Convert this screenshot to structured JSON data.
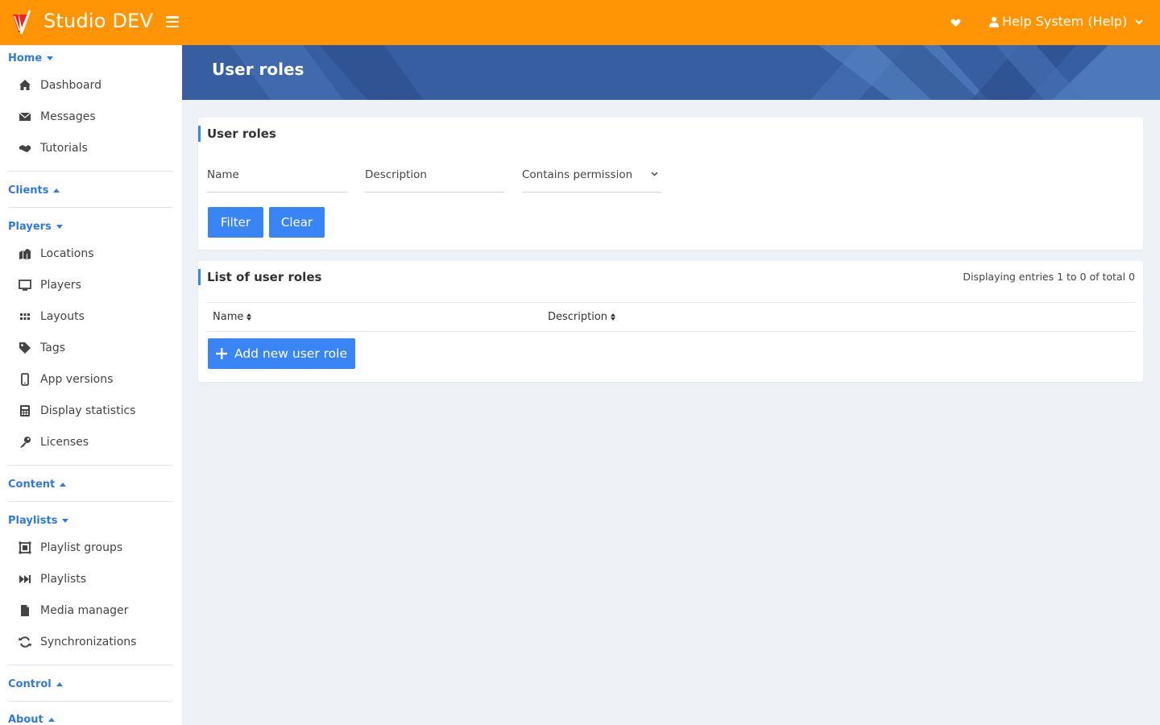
{
  "app": {
    "brand": "Studio DEV",
    "accent_color": "#ff9505",
    "primary_color": "#3a85f5",
    "user_label": "Help System (Help)"
  },
  "sidebar": {
    "sections": [
      {
        "label": "Home",
        "state": "expanded",
        "items": [
          {
            "label": "Dashboard",
            "icon": "home-icon"
          },
          {
            "label": "Messages",
            "icon": "envelope-icon"
          },
          {
            "label": "Tutorials",
            "icon": "handshake-icon"
          }
        ]
      },
      {
        "label": "Clients",
        "state": "collapsed",
        "items": []
      },
      {
        "label": "Players",
        "state": "expanded",
        "items": [
          {
            "label": "Locations",
            "icon": "map-marker-icon"
          },
          {
            "label": "Players",
            "icon": "monitor-icon"
          },
          {
            "label": "Layouts",
            "icon": "grid-icon"
          },
          {
            "label": "Tags",
            "icon": "tag-icon"
          },
          {
            "label": "App versions",
            "icon": "mobile-icon"
          },
          {
            "label": "Display statistics",
            "icon": "calculator-icon"
          },
          {
            "label": "Licenses",
            "icon": "key-icon"
          }
        ]
      },
      {
        "label": "Content",
        "state": "collapsed",
        "items": []
      },
      {
        "label": "Playlists",
        "state": "expanded",
        "items": [
          {
            "label": "Playlist groups",
            "icon": "object-group-icon"
          },
          {
            "label": "Playlists",
            "icon": "fast-forward-icon"
          },
          {
            "label": "Media manager",
            "icon": "file-icon"
          },
          {
            "label": "Synchronizations",
            "icon": "sync-icon"
          }
        ]
      },
      {
        "label": "Control",
        "state": "collapsed",
        "items": []
      },
      {
        "label": "About",
        "state": "collapsed",
        "items": []
      }
    ]
  },
  "page": {
    "title": "User roles"
  },
  "filter_card": {
    "title": "User roles",
    "name_placeholder": "Name",
    "description_placeholder": "Description",
    "permission_select": "Contains permission",
    "filter_button": "Filter",
    "clear_button": "Clear"
  },
  "list_card": {
    "title": "List of user roles",
    "entries_info": "Displaying entries 1 to 0 of total 0",
    "columns": [
      "Name",
      "Description"
    ],
    "add_button": "Add new user role"
  }
}
